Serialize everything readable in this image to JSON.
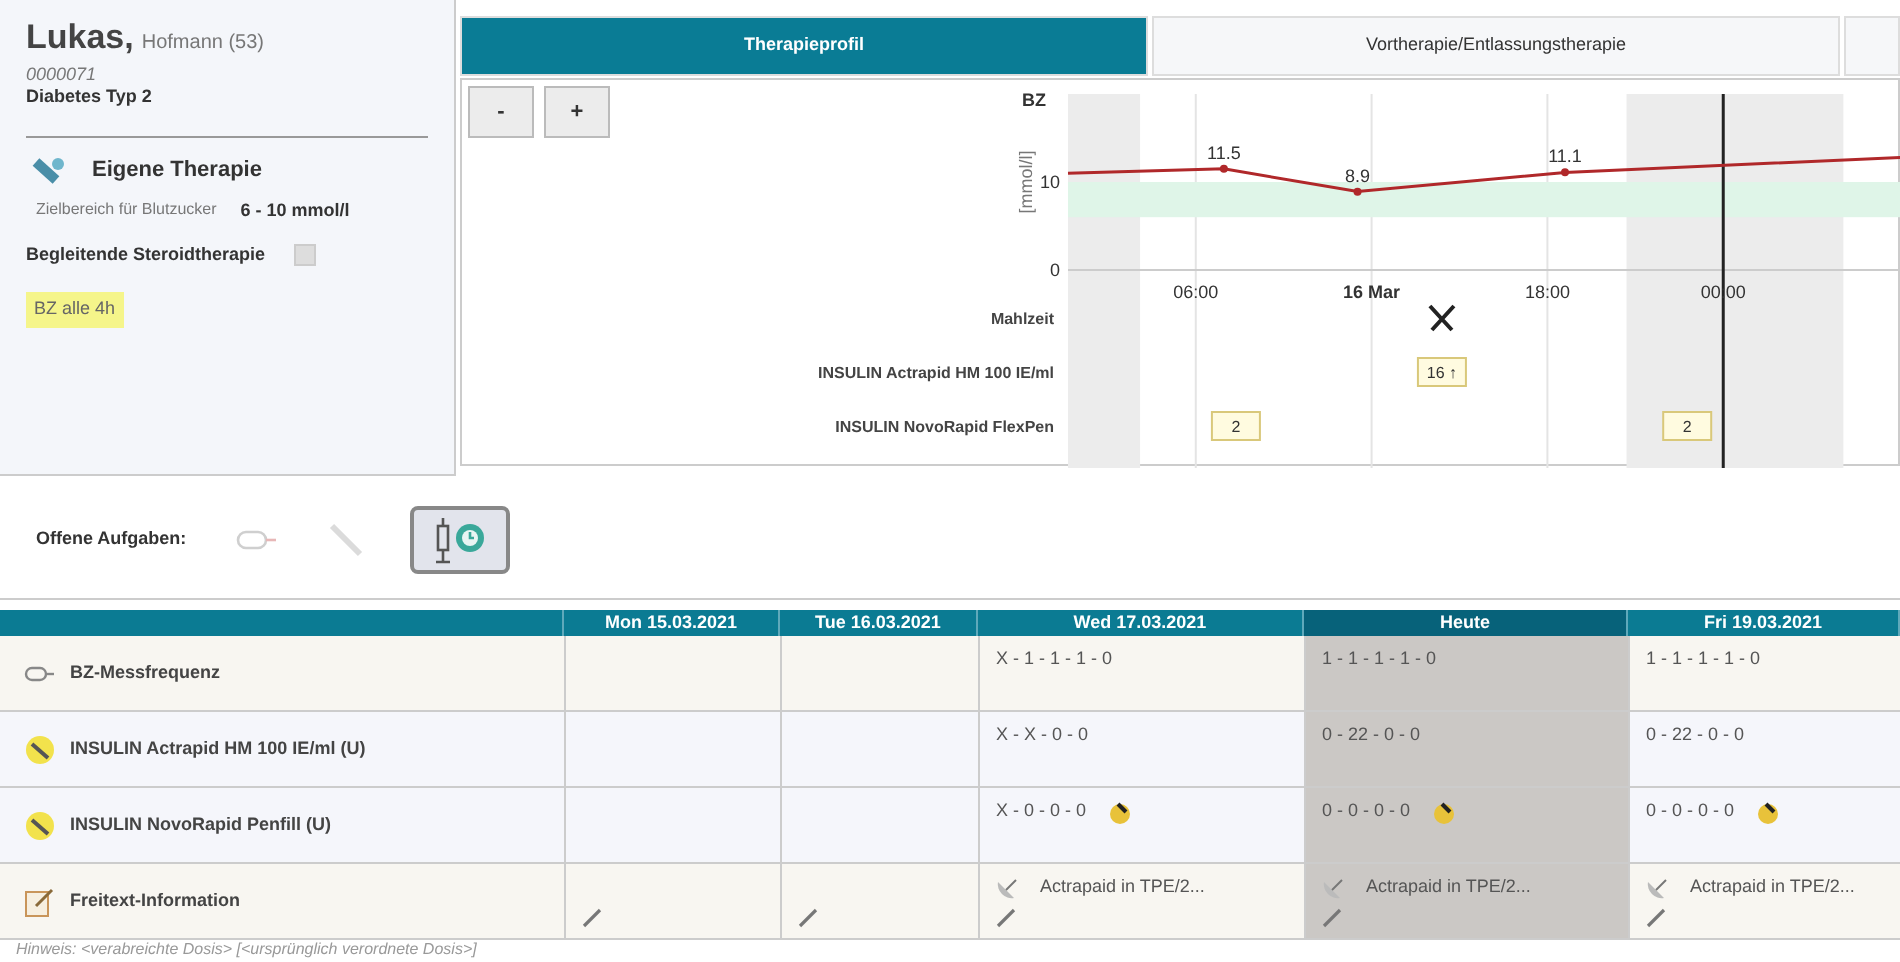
{
  "patient": {
    "last_name": "Lukas,",
    "first_name_age": "Hofmann (53)",
    "id": "0000071",
    "diagnosis": "Diabetes Typ 2"
  },
  "therapy": {
    "title": "Eigene Therapie",
    "target_label": "Zielbereich für Blutzucker",
    "target_value": "6 - 10 mmol/l"
  },
  "steroid": {
    "label": "Begleitende Steroidtherapie",
    "checked": false
  },
  "tag": "BZ alle 4h",
  "tabs": [
    {
      "label": "Therapieprofil",
      "selected": true
    },
    {
      "label": "Vortherapie/Entlassungstherapie",
      "selected": false
    }
  ],
  "zoom_buttons": [
    "-",
    "+"
  ],
  "chart": {
    "chart_data": {
      "type": "line",
      "title": "BZ",
      "ylabel": "[mmol/l]",
      "x": [
        1.64,
        6.96,
        11.52,
        18.6,
        30.1
      ],
      "xlim": [
        1.64,
        30.1
      ],
      "ylim": [
        0,
        20
      ],
      "yticks": [
        0,
        10
      ],
      "xticks": [
        {
          "value": 6,
          "label": "06:00"
        },
        {
          "value": 12,
          "label": "16 Mar"
        },
        {
          "value": 18,
          "label": "18:00"
        },
        {
          "value": 24,
          "label": "00:00"
        }
      ],
      "series": [
        {
          "color": "#b0282a",
          "values": [
            11.0,
            11.5,
            8.9,
            11.1,
            12.8
          ]
        }
      ],
      "grid": true,
      "value_labels": [
        null,
        "11.5",
        "8.9",
        "11.1",
        null
      ],
      "bands": [
        {
          "axis": "y",
          "from": 6,
          "to": 10,
          "color": "#dff5e8"
        },
        {
          "axis": "x",
          "from": 1.64,
          "to": 4.1,
          "color": "#ececec"
        },
        {
          "axis": "x",
          "from": 20.7,
          "to": 28.1,
          "color": "#ececec"
        }
      ],
      "ref_lines": [
        {
          "axis": "x",
          "value": 24,
          "color": "#222222"
        }
      ]
    },
    "event_rows": [
      {
        "label": "Mahlzeit",
        "events": [
          {
            "kind": "meal"
          }
        ]
      },
      {
        "label": "INSULIN Actrapid HM 100 IE/ml",
        "events": [
          {
            "kind": "dose",
            "text": "16 ↑"
          }
        ]
      },
      {
        "label": "INSULIN NovoRapid FlexPen",
        "events": [
          {
            "kind": "dose",
            "text": "2"
          },
          {
            "kind": "dose",
            "text": "2"
          }
        ]
      }
    ]
  },
  "tasks": {
    "label": "Offene Aufgaben:",
    "items": [
      {
        "kind": "glucometer",
        "selected": false
      },
      {
        "kind": "syringe",
        "selected": false
      },
      {
        "kind": "syringe-clock",
        "selected": true
      }
    ]
  },
  "table": {
    "columns": [
      {
        "label": "Mon 15.03.2021",
        "today": false
      },
      {
        "label": "Tue 16.03.2021",
        "today": false
      },
      {
        "label": "Wed 17.03.2021",
        "today": false
      },
      {
        "label": "Heute",
        "today": true
      },
      {
        "label": "Fri 19.03.2021",
        "today": false
      }
    ],
    "rows": [
      {
        "kind": "measure",
        "label": "BZ-Messfrequenz",
        "cells": [
          {},
          {},
          {
            "text": "X - 1 - 1 - 1 - 0"
          },
          {
            "text": "1 - 1 - 1 - 1 - 0"
          },
          {
            "text": "1 - 1 - 1 - 1 - 0"
          }
        ]
      },
      {
        "kind": "insulin",
        "label": "INSULIN Actrapid HM 100 IE/ml (U)",
        "cells": [
          {},
          {},
          {
            "text": "X - X - 0 - 0"
          },
          {
            "text": "0 - 22 - 0 - 0"
          },
          {
            "text": "0 - 22 - 0 - 0"
          }
        ]
      },
      {
        "kind": "insulin",
        "label": "INSULIN NovoRapid Penfill (U)",
        "cells": [
          {},
          {},
          {
            "text": "X - 0 - 0 - 0",
            "marked": true
          },
          {
            "text": "0 - 0 - 0 - 0",
            "marked": true
          },
          {
            "text": "0 - 0 - 0 - 0",
            "marked": true
          }
        ]
      },
      {
        "kind": "note",
        "label": "Freitext-Information",
        "cells": [
          {
            "editable": true
          },
          {
            "editable": true
          },
          {
            "text": "Actrapaid in TPE/2...",
            "editable": true
          },
          {
            "text": "Actrapaid in TPE/2...",
            "editable": true
          },
          {
            "text": "Actrapaid in TPE/2...",
            "editable": true
          }
        ]
      }
    ]
  },
  "footnote": "Hinweis: <verabreichte Dosis> [<ursprünglich verordnete Dosis>]"
}
